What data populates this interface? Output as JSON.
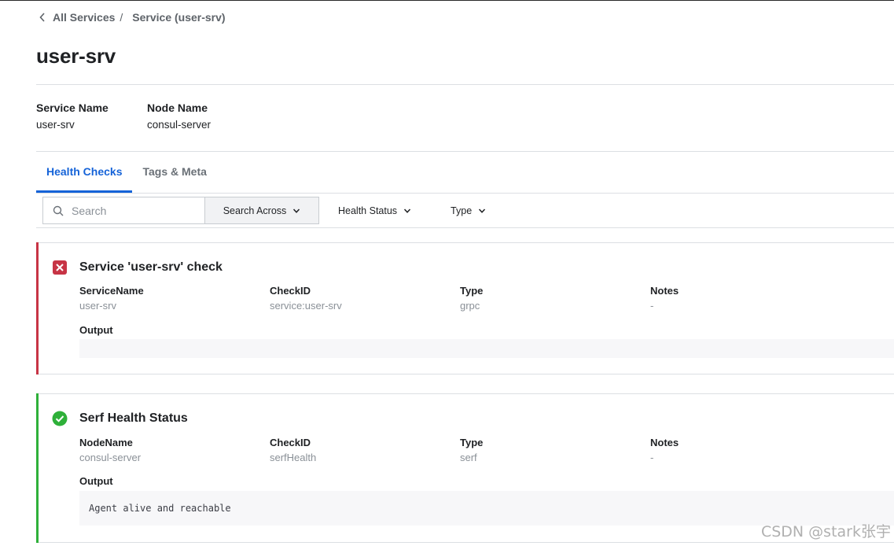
{
  "breadcrumb": {
    "root": "All Services",
    "separator": "/",
    "current": "Service (user-srv)"
  },
  "page_title": "user-srv",
  "service_meta": [
    {
      "key": "Service Name",
      "value": "user-srv"
    },
    {
      "key": "Node Name",
      "value": "consul-server"
    }
  ],
  "tabs": [
    {
      "label": "Health Checks",
      "active": true
    },
    {
      "label": "Tags & Meta",
      "active": false
    }
  ],
  "filters": {
    "search_placeholder": "Search",
    "search_across": "Search Across",
    "health_status": "Health Status",
    "type": "Type"
  },
  "checks": [
    {
      "status": "critical",
      "status_color": "#c73445",
      "icon": "x-square-icon",
      "title": "Service 'user-srv' check",
      "fields": [
        {
          "key": "ServiceName",
          "value": "user-srv"
        },
        {
          "key": "CheckID",
          "value": "service:user-srv"
        },
        {
          "key": "Type",
          "value": "grpc"
        },
        {
          "key": "Notes",
          "value": "-"
        }
      ],
      "output_label": "Output",
      "output": ""
    },
    {
      "status": "passing",
      "status_color": "#2eb039",
      "icon": "check-circle-icon",
      "title": "Serf Health Status",
      "fields": [
        {
          "key": "NodeName",
          "value": "consul-server"
        },
        {
          "key": "CheckID",
          "value": "serfHealth"
        },
        {
          "key": "Type",
          "value": "serf"
        },
        {
          "key": "Notes",
          "value": "-"
        }
      ],
      "output_label": "Output",
      "output": "Agent alive and reachable"
    }
  ],
  "watermark": "CSDN @stark张宇",
  "colors": {
    "accent": "#1563d8",
    "critical": "#c73445",
    "passing": "#2eb039"
  }
}
